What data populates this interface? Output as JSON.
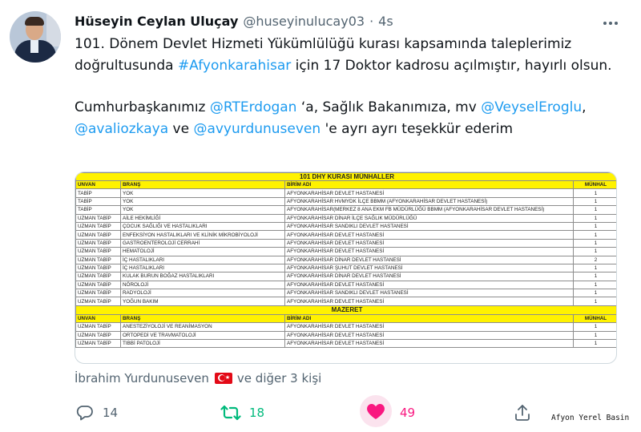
{
  "author": {
    "name": "Hüseyin Ceylan Uluçay",
    "handle": "@huseyinulucay03",
    "dot": "·",
    "time": "4s"
  },
  "tweet": {
    "p1_a": "101. Dönem Devlet Hizmeti Yükümlülüğü kurası kapsamında taleplerimiz doğrultusunda ",
    "hashtag": "#Afyonkarahisar",
    "p1_b": " için 17 Doktor kadrosu açılmıştır, hayırlı olsun.",
    "p2_a": "Cumhurbaşkanımız ",
    "m1": "@RTErdogan",
    "p2_b": " ‘a, Sağlık Bakanımıza, mv ",
    "m2": "@VeyselEroglu",
    "p2_c": ", ",
    "m3": "@avaliozkaya",
    "p2_d": " ve ",
    "m4": "@avyurdunuseven",
    "p2_e": " 'e ayrı ayrı teşekkür ederim"
  },
  "document": {
    "title": "101 DHY KURASI MÜNHALLER",
    "headers": [
      "UNVAN",
      "BRANŞ",
      "BİRİM ADI",
      "MÜNHAL"
    ],
    "rows": [
      [
        "TABİP",
        "YOK",
        "AFYONKARAHİSAR DEVLET HASTANESİ",
        "1"
      ],
      [
        "TABİP",
        "YOK",
        "AFYONKARAHİSAR HVMYDK İLÇE BBMM (AFYONKARAHİSAR DEVLET HASTANESİ)",
        "1"
      ],
      [
        "TABİP",
        "YOK",
        "AFYONKARAHİSAR(MERKEZ 8 ANA EKM FB MÜDÜRLÜĞÜ BBMM (AFYONKARAHİSAR DEVLET HASTANESİ)",
        "1"
      ],
      [
        "UZMAN TABİP",
        "AİLE HEKİMLİĞİ",
        "AFYONKARAHİSAR DİNAR İLÇE SAĞLIK MÜDÜRLÜĞÜ",
        "1"
      ],
      [
        "UZMAN TABİP",
        "ÇOCUK SAĞLIĞI VE HASTALIKLARI",
        "AFYONKARAHİSAR SANDIKLI DEVLET HASTANESİ",
        "1"
      ],
      [
        "UZMAN TABİP",
        "ENFEKSİYON HASTALIKLARI VE KLİNİK MİKROBİYOLOJİ",
        "AFYONKARAHİSAR DEVLET HASTANESİ",
        "1"
      ],
      [
        "UZMAN TABİP",
        "GASTROENTEROLOJİ CERRAHİ",
        "AFYONKARAHİSAR DEVLET HASTANESİ",
        "1"
      ],
      [
        "UZMAN TABİP",
        "HEMATOLOJİ",
        "AFYONKARAHİSAR DEVLET HASTANESİ",
        "1"
      ],
      [
        "UZMAN TABİP",
        "İÇ HASTALIKLARI",
        "AFYONKARAHİSAR DİNAR DEVLET HASTANESİ",
        "2"
      ],
      [
        "UZMAN TABİP",
        "İÇ HASTALIKLARI",
        "AFYONKARAHİSAR ŞUHUT DEVLET HASTANESİ",
        "1"
      ],
      [
        "UZMAN TABİP",
        "KULAK BURUN BOĞAZ HASTALIKLARI",
        "AFYONKARAHİSAR DİNAR DEVLET HASTANESİ",
        "1"
      ],
      [
        "UZMAN TABİP",
        "NÖROLOJİ",
        "AFYONKARAHİSAR DEVLET HASTANESİ",
        "1"
      ],
      [
        "UZMAN TABİP",
        "RADYOLOJİ",
        "AFYONKARAHİSAR SANDIKLI DEVLET HASTANESİ",
        "1"
      ],
      [
        "UZMAN TABİP",
        "YOĞUN BAKIM",
        "AFYONKARAHİSAR DEVLET HASTANESİ",
        "1"
      ]
    ],
    "mazeret_title": "MAZERET",
    "mazeret_rows": [
      [
        "UZMAN TABİP",
        "ANESTEZİYOLOJİ VE REANİMASYON",
        "AFYONKARAHİSAR DEVLET HASTANESİ",
        "1"
      ],
      [
        "UZMAN TABİP",
        "ORTOPEDİ VE TRAVMATOLOJİ",
        "AFYONKARAHİSAR DEVLET HASTANESİ",
        "1"
      ],
      [
        "UZMAN TABİP",
        "TIBBİ PATOLOJİ",
        "AFYONKARAHİSAR DEVLET HASTANESİ",
        "1"
      ]
    ]
  },
  "liked_by": {
    "name": "İbrahim Yurdunuseven",
    "rest": "ve diğer 3 kişi"
  },
  "actions": {
    "reply_count": "14",
    "retweet_count": "18",
    "like_count": "49"
  },
  "icons": {
    "reply": "reply-icon",
    "retweet": "retweet-icon",
    "like": "heart-icon",
    "share": "share-icon",
    "more": "more-icon",
    "flag": "turkish-flag-icon"
  },
  "colors": {
    "link": "#1d9bf0",
    "retweet": "#00ba7c",
    "like": "#f91880",
    "table_highlight": "#fff200"
  },
  "watermark": "Afyon Yerel Basin"
}
